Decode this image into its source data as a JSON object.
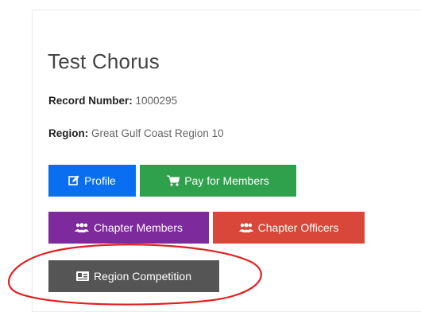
{
  "chapter": {
    "name": "Test Chorus",
    "record_number_label": "Record Number:",
    "record_number": "1000295",
    "region_label": "Region:",
    "region": "Great Gulf Coast Region 10"
  },
  "actions": {
    "profile": {
      "label": "Profile",
      "icon": "edit-icon",
      "color": "#0a6ef0"
    },
    "pay_for_members": {
      "label": "Pay for Members",
      "icon": "cart-icon",
      "color": "#2fa14c"
    },
    "chapter_members": {
      "label": "Chapter Members",
      "icon": "users-icon",
      "color": "#7d2a9c"
    },
    "chapter_officers": {
      "label": "Chapter Officers",
      "icon": "users-icon",
      "color": "#d9473a"
    },
    "region_competition": {
      "label": "Region Competition",
      "icon": "id-card-icon",
      "color": "#555555"
    }
  },
  "annotation": {
    "color": "#e02020"
  }
}
